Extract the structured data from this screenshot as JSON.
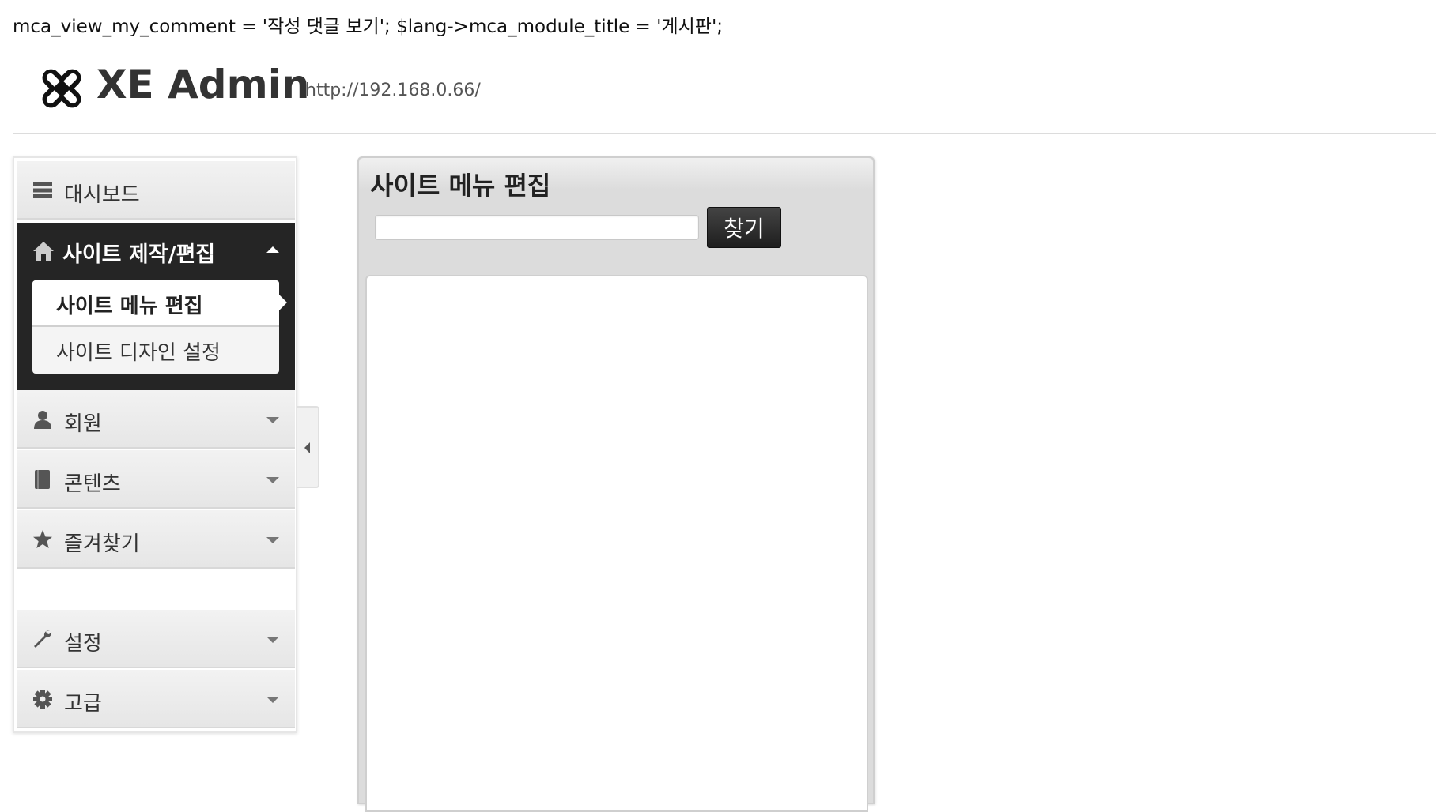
{
  "debug_text": "mca_view_my_comment = '작성 댓글 보기'; $lang->mca_module_title = '게시판';",
  "header": {
    "logo_text": "XE Admin",
    "site_url": "http://192.168.0.66/"
  },
  "sidebar": {
    "dashboard": {
      "label": "대시보드",
      "icon": "list-icon"
    },
    "site_build": {
      "label": "사이트 제작/편집",
      "icon": "home-icon",
      "expanded": true,
      "sub_items": [
        {
          "label": "사이트 메뉴 편집",
          "current": true
        },
        {
          "label": "사이트 디자인 설정",
          "current": false
        }
      ]
    },
    "members": {
      "label": "회원",
      "icon": "user-icon"
    },
    "contents": {
      "label": "콘텐츠",
      "icon": "book-icon"
    },
    "favorites": {
      "label": "즐겨찾기",
      "icon": "star-icon"
    },
    "settings": {
      "label": "설정",
      "icon": "wrench-icon"
    },
    "advanced": {
      "label": "고급",
      "icon": "gear-icon"
    }
  },
  "panel": {
    "title": "사이트 메뉴 편집",
    "search_value": "",
    "search_button": "찾기"
  }
}
